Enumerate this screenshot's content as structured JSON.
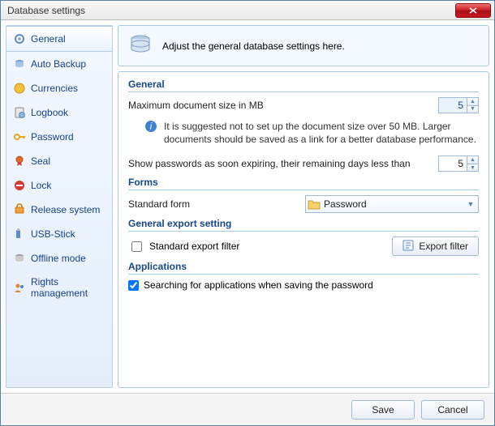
{
  "window": {
    "title": "Database settings"
  },
  "sidebar": {
    "items": [
      {
        "label": "General"
      },
      {
        "label": "Auto Backup"
      },
      {
        "label": "Currencies"
      },
      {
        "label": "Logbook"
      },
      {
        "label": "Password"
      },
      {
        "label": "Seal"
      },
      {
        "label": "Lock"
      },
      {
        "label": "Release system"
      },
      {
        "label": "USB-Stick"
      },
      {
        "label": "Offline mode"
      },
      {
        "label": "Rights management"
      }
    ]
  },
  "header": {
    "hint": "Adjust the general database settings here."
  },
  "sections": {
    "general": {
      "title": "General",
      "max_doc_label": "Maximum document size in MB",
      "max_doc_value": "5",
      "suggestion": "It is suggested not to set up the document size over 50 MB. Larger documents should be saved as a link for a better database performance.",
      "expire_label": "Show passwords as soon expiring, their remaining days less than",
      "expire_value": "5"
    },
    "forms": {
      "title": "Forms",
      "standard_label": "Standard form",
      "selected": "Password"
    },
    "export": {
      "title": "General export setting",
      "filter_label": "Standard export filter",
      "filter_checked": false,
      "button": "Export filter"
    },
    "apps": {
      "title": "Applications",
      "search_label": "Searching for applications when saving the password",
      "search_checked": true
    }
  },
  "footer": {
    "save": "Save",
    "cancel": "Cancel"
  }
}
